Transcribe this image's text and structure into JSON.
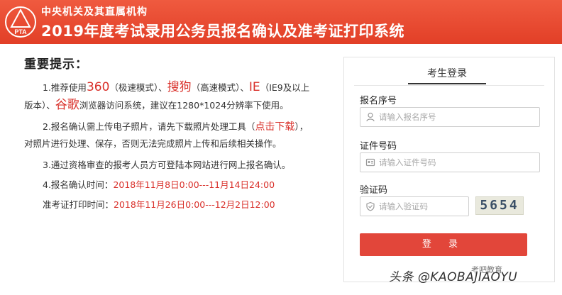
{
  "header": {
    "org_name": "中央机关及其直属机构",
    "title": "2019年度考试录用公务员报名确认及准考证打印系统",
    "logo_text": "PTA",
    "brand_color": "#e8482f"
  },
  "notice": {
    "title": "重要提示：",
    "p1": {
      "a": "1.推荐使用",
      "b": "360",
      "c": "（极速模式）、",
      "d": "搜狗",
      "e": "（高速模式）、",
      "f": "IE",
      "g": "（IE9及以上版本）、",
      "h": "谷歌",
      "i": "浏览器访问系统，建议在1280*1024分辨率下使用。"
    },
    "p2": {
      "a": "2.报名确认需上传电子照片，请先下载照片处理工具（",
      "link": "点击下载",
      "b": "），对照片进行处理、保存，否则无法完成照片上传和后续相关操作。"
    },
    "p3": "3.通过资格审查的报考人员方可登陆本网站进行网上报名确认。",
    "confirm_label": "4.报名确认时间：",
    "confirm_time": "2018年11月8日0:00---11月14日24:00",
    "print_label": "准考证打印时间：",
    "print_time": "2018年11月26日0:00---12月2日12:00"
  },
  "login": {
    "tab_label": "考生登录",
    "reg_label": "报名序号",
    "reg_placeholder": "请输入报名序号",
    "id_label": "证件号码",
    "id_placeholder": "请输入证件号码",
    "captcha_label": "验证码",
    "captcha_placeholder": "请输入验证码",
    "captcha_text": "5654",
    "submit_label": "登 录",
    "accent_color": "#e2463a"
  },
  "watermark": {
    "text": "头条 @KAOBAJIAOYU",
    "source": "考吧教育"
  }
}
